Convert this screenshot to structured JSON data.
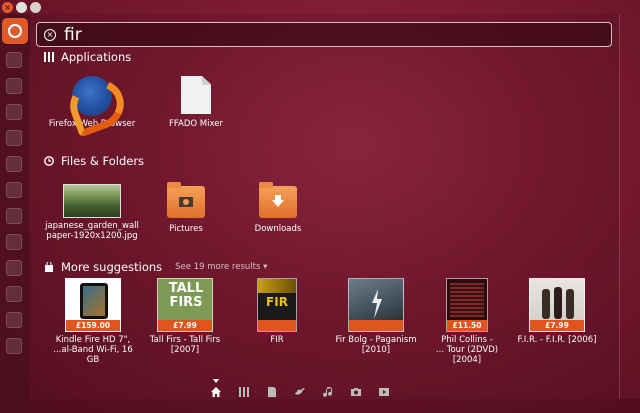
{
  "search": {
    "query": "fir"
  },
  "categories": {
    "applications": {
      "title": "Applications"
    },
    "files": {
      "title": "Files & Folders"
    },
    "suggestions": {
      "title": "More suggestions",
      "more": "See 19 more results"
    }
  },
  "applications": [
    {
      "label": "Firefox Web Browser",
      "icon": "firefox-icon"
    },
    {
      "label": "FFADO Mixer",
      "icon": "document-icon"
    }
  ],
  "files": [
    {
      "label": "japanese_garden_wall\npaper-1920x1200.jpg",
      "icon": "image-thumbnail"
    },
    {
      "label": "Pictures",
      "icon": "pictures-folder-icon"
    },
    {
      "label": "Downloads",
      "icon": "downloads-folder-icon"
    }
  ],
  "suggestions": [
    {
      "label": "Kindle Fire HD 7\",\n...al-Band Wi-Fi, 16 GB",
      "price": "£159.00"
    },
    {
      "label": "Tall Firs - Tall Firs\n[2007]",
      "price": "£7.99",
      "art_text": "TALL\nFIRS"
    },
    {
      "label": "FIR",
      "price": "",
      "art_text": "FIR"
    },
    {
      "label": "Fir Bolg - Paganism\n[2010]",
      "price": ""
    },
    {
      "label": "Phil Collins -\n... Tour (2DVD) [2004]",
      "price": "£11.50"
    },
    {
      "label": "F.I.R. - F.I.R. [2006]",
      "price": "£7.99"
    }
  ],
  "lenses": [
    "home-lens-icon",
    "applications-lens-icon",
    "files-lens-icon",
    "social-lens-icon",
    "music-lens-icon",
    "photos-lens-icon",
    "video-lens-icon"
  ],
  "colors": {
    "accent": "#e0541e",
    "background": "#7a1a30"
  }
}
